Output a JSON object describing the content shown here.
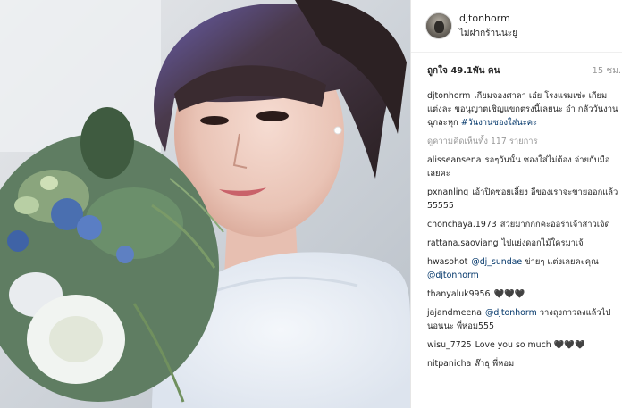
{
  "post": {
    "username": "djtonhorm",
    "location": "ไม่ฝากร้านนะยู",
    "likes": "ถูกใจ 49.1พัน คน",
    "timestamp": "15 ชม."
  },
  "caption": {
    "user": "djtonhorm",
    "text": "เกียมจองศาลา เอ๋ย โรงแรมเซ่ะ เกียมแต่งละ ขอนุญาตเชิญแขกตรงนี้เลยนะ อ๋า กลัววันงานฉุกละหุก",
    "hashtag": "#วันงานซองใส่นะคะ"
  },
  "view_all": "ดูความคิดเห็นทั้ง 117 รายการ",
  "comments": [
    {
      "user": "alisseansena",
      "text": "รอๆวันนั้น ซองใส่ไม่ต้อง จ่ายกับมือเลยคะ"
    },
    {
      "user": "pxnanling",
      "text": "เอ้าปิดซอยเลี้ยง อีของเราจะขายออกแล้ว 55555"
    },
    {
      "user": "chonchaya.1973",
      "text": "สวยมากกกคะออร่าเจ้าสาวเจิด"
    },
    {
      "user": "rattana.saoviang",
      "text": "ไปแย่งดอกไม้ใครมาเจ้"
    },
    {
      "user": "hwasohot",
      "mention": "@dj_sundae",
      "text": "ข่ายๆ แต่งเลยคะคุณ",
      "mention2": "@djtonhorm"
    },
    {
      "user": "thanyaluk9956",
      "text": "🖤🖤🖤"
    },
    {
      "user": "jajandmeena",
      "mention": "@djtonhorm",
      "text": "วางถุงกาวลงแล้วไปนอนนะ พี่หอม555"
    },
    {
      "user": "wisu_7725",
      "text": "Love you so much 🖤🖤🖤"
    },
    {
      "user": "nitpanicha",
      "text": "ส๊าธุ พี่หอม"
    }
  ]
}
